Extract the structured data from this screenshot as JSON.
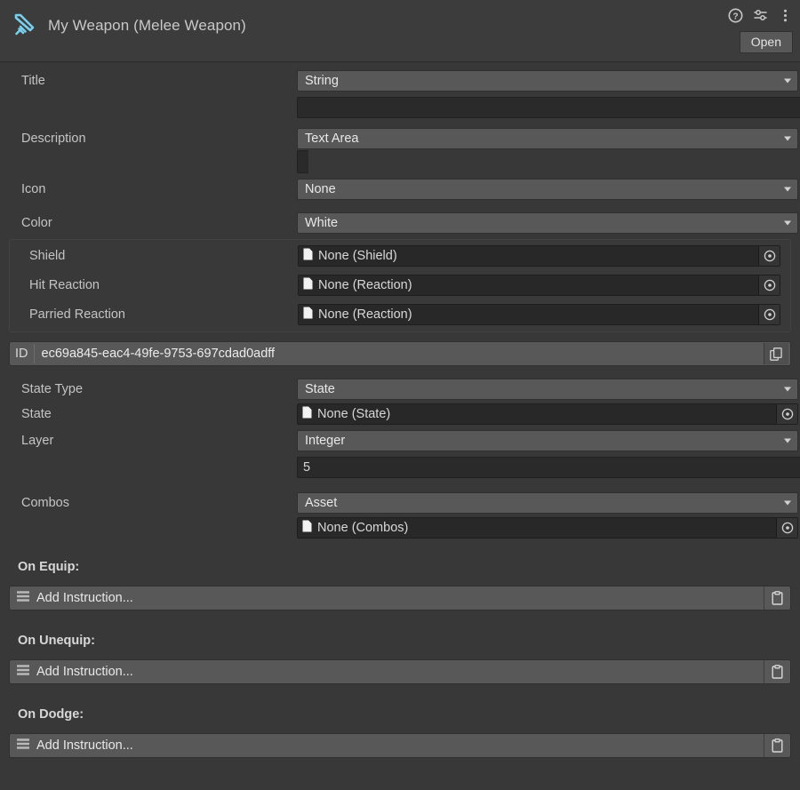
{
  "header": {
    "icon": "sword-icon",
    "title": "My Weapon (Melee Weapon)",
    "help_icon": "help-icon",
    "preset_icon": "preset-icon",
    "more_icon": "more-menu-icon",
    "open_label": "Open"
  },
  "fields": {
    "title": {
      "label": "Title",
      "type_value": "String",
      "value": "",
      "placeholder": ""
    },
    "description": {
      "label": "Description",
      "type_value": "Text Area",
      "value": "",
      "placeholder": ""
    },
    "icon": {
      "label": "Icon",
      "type_value": "None"
    },
    "color": {
      "label": "Color",
      "type_value": "White"
    }
  },
  "group": {
    "rows": [
      {
        "label": "Shield",
        "value": "None (Shield)"
      },
      {
        "label": "Hit Reaction",
        "value": "None (Reaction)"
      },
      {
        "label": "Parried Reaction",
        "value": "None (Reaction)"
      }
    ]
  },
  "id_field": {
    "label": "ID",
    "value": "ec69a845-eac4-49fe-9753-697cdad0adff",
    "copy_icon": "copy-icon"
  },
  "state_section": {
    "state_type": {
      "label": "State Type",
      "value": "State"
    },
    "state": {
      "label": "State",
      "value": "None (State)"
    },
    "layer": {
      "label": "Layer",
      "type_value": "Integer",
      "value": "5"
    }
  },
  "combos": {
    "label": "Combos",
    "type_value": "Asset",
    "object_value": "None (Combos)"
  },
  "events": [
    {
      "title": "On Equip:",
      "instruction": "Add Instruction...",
      "paste_icon": "clipboard-icon"
    },
    {
      "title": "On Unequip:",
      "instruction": "Add Instruction...",
      "paste_icon": "clipboard-icon"
    },
    {
      "title": "On Dodge:",
      "instruction": "Add Instruction...",
      "paste_icon": "clipboard-icon"
    }
  ],
  "colors": {
    "background": "#383838",
    "header": "#3c3c3c",
    "dropdown": "#585858",
    "input": "#2a2a2a",
    "object_field": "#282828",
    "accent_icon": "#79cfee",
    "text": "#c4c4c4"
  }
}
